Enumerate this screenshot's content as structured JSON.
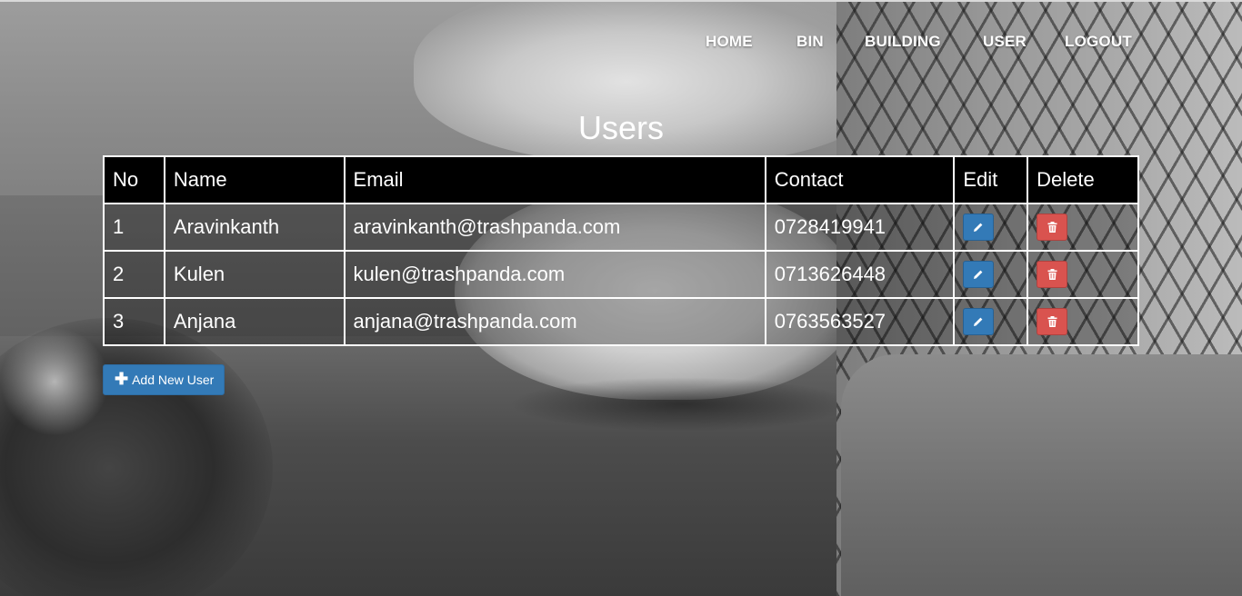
{
  "nav": {
    "items": [
      {
        "label": "HOME"
      },
      {
        "label": "BIN"
      },
      {
        "label": "BUILDING"
      },
      {
        "label": "USER"
      },
      {
        "label": "LOGOUT"
      }
    ]
  },
  "page": {
    "title": "Users"
  },
  "table": {
    "headers": [
      "No",
      "Name",
      "Email",
      "Contact",
      "Edit",
      "Delete"
    ],
    "rows": [
      {
        "no": "1",
        "name": "Aravinkanth",
        "email": "aravinkanth@trashpanda.com",
        "contact": "0728419941"
      },
      {
        "no": "2",
        "name": "Kulen",
        "email": "kulen@trashpanda.com",
        "contact": "0713626448"
      },
      {
        "no": "3",
        "name": "Anjana",
        "email": "anjana@trashpanda.com",
        "contact": "0763563527"
      }
    ]
  },
  "actions": {
    "add_user_label": "Add New User",
    "edit_icon": "pencil-icon",
    "delete_icon": "trash-icon"
  },
  "colors": {
    "primary": "#337ab7",
    "danger": "#d9534f",
    "header_bg": "#000000"
  }
}
